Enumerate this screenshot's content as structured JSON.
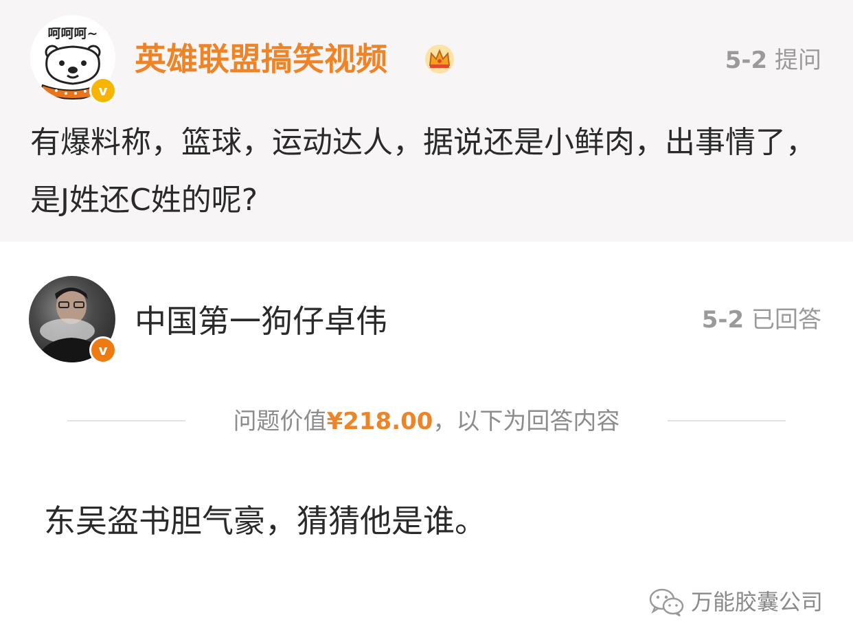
{
  "question": {
    "avatar_caption": "呵呵呵~",
    "author_name": "英雄联盟搞笑视频",
    "date": "5-2",
    "status": "提问",
    "text": "有爆料称，篮球，运动达人，据说还是小鲜肉，出事情了，是J姓还C姓的呢?"
  },
  "answer": {
    "author_name": "中国第一狗仔卓伟",
    "date": "5-2",
    "status": "已回答",
    "value_prefix": "问题价值",
    "price": "¥218.00",
    "value_suffix": "，以下为回答内容",
    "text": "东吴盗书胆气豪，猜猜他是谁。"
  },
  "watermark": {
    "text": "万能胶囊公司",
    "icon": "wechat-icon"
  },
  "colors": {
    "accent": "#ee8428",
    "badge_yellow": "#f7b500",
    "badge_orange": "#ee7a12",
    "question_bg": "#f7f5f5"
  }
}
